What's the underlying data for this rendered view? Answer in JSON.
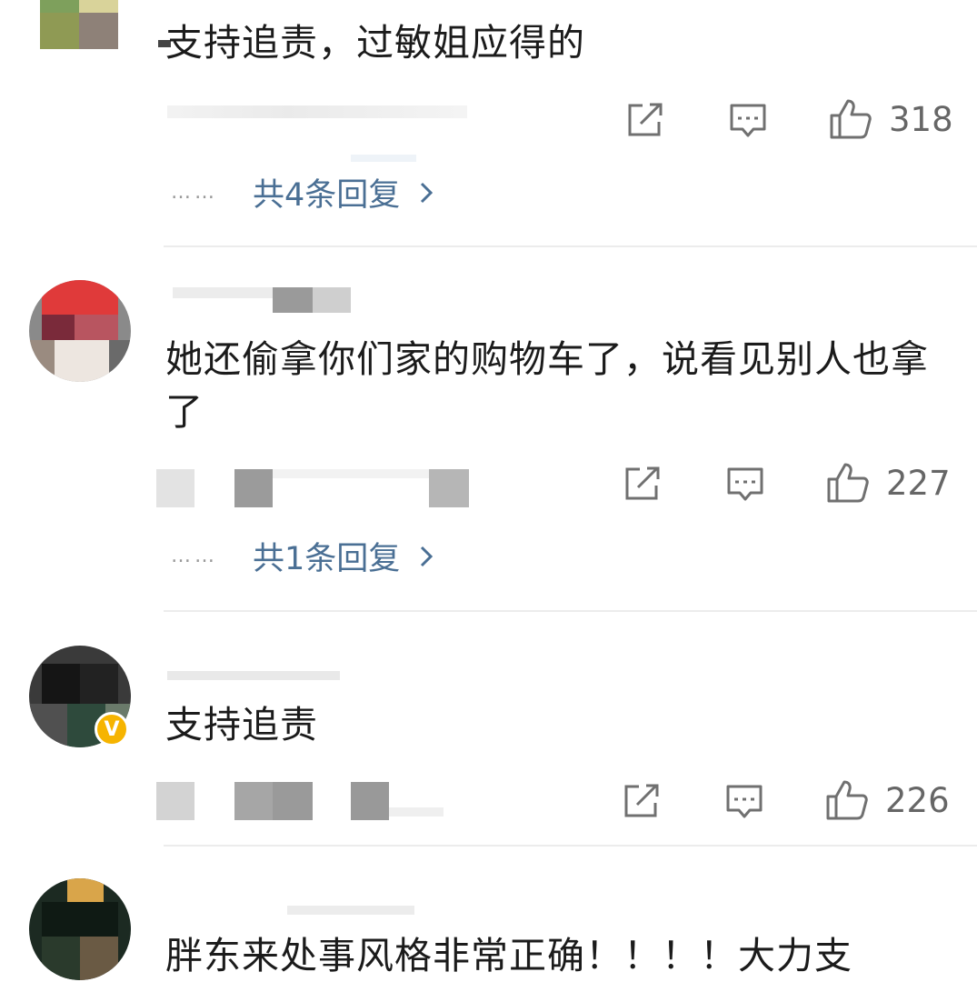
{
  "comments": [
    {
      "text": "支持追责，过敏姐应得的",
      "likes": "318",
      "replies_label": "共4条回复",
      "dots": "……"
    },
    {
      "text": "她还偷拿你们家的购物车了，说看见别人也拿了",
      "likes": "227",
      "replies_label": "共1条回复",
      "dots": "……"
    },
    {
      "text": "支持追责",
      "likes": "226",
      "verified_mark": "V"
    },
    {
      "text": "胖东来处事风格非常正确！！！！大力支"
    }
  ],
  "icons": {
    "share": "share-icon",
    "comment": "comment-icon",
    "like": "thumbs-up-icon",
    "chevron": "chevron-right-icon"
  },
  "colors": {
    "link": "#4a6f94",
    "icon": "#707070",
    "count": "#666666",
    "verified": "#f6b400",
    "divider": "#ececec"
  }
}
